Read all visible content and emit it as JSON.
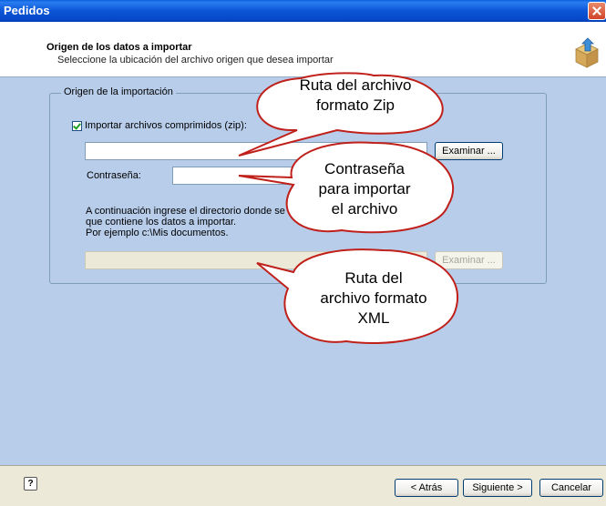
{
  "window": {
    "title": "Pedidos"
  },
  "header": {
    "title": "Origen de los datos a importar",
    "subtitle": "Seleccione la ubicación del archivo origen que desea importar"
  },
  "group": {
    "legend": "Origen de la importación",
    "checkbox_label": "Importar archivos comprimidos (zip):",
    "checkbox_checked": true,
    "zip_path_value": "",
    "browse_label": "Examinar ...",
    "password_label": "Contraseña:",
    "password_value": "",
    "info_line1": "A continuación ingrese el directorio donde se e",
    "info_line2": "que contiene los datos a importar.",
    "info_line3": "Por ejemplo c:\\Mis documentos.",
    "dir_path_value": "",
    "browse2_label": "Examinar ..."
  },
  "callouts": {
    "zip": {
      "line1": "Ruta del archivo",
      "line2": "formato Zip"
    },
    "password": {
      "line1": "Contraseña",
      "line2": "para importar",
      "line3": "el archivo"
    },
    "xml": {
      "line1": "Ruta del",
      "line2": "archivo formato",
      "line3": "XML"
    }
  },
  "footer": {
    "help_icon": "help-icon",
    "back_label": "< Atrás",
    "next_label": "Siguiente >",
    "cancel_label": "Cancelar"
  },
  "colors": {
    "body_bg": "#b7cdea",
    "title_bar": "#0b55d6",
    "callout_border": "#c0201a"
  }
}
